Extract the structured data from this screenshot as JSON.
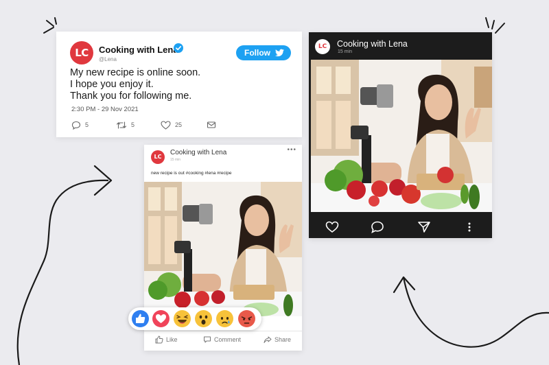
{
  "twitter": {
    "avatar_initials": "LC",
    "name": "Cooking with Lena",
    "handle": "@Lena",
    "follow_label": "Follow",
    "lines": [
      "My new recipe is online soon.",
      "I hope you enjoy it.",
      "Thank you for following me."
    ],
    "timestamp": "2:30 PM - 29 Nov 2021",
    "reply_count": "5",
    "retweet_count": "5",
    "like_count": "25",
    "icons": [
      "verified-icon",
      "twitter-bird-icon",
      "reply-icon",
      "retweet-icon",
      "heart-icon",
      "message-icon"
    ],
    "colors": {
      "accent": "#1da1f2",
      "avatar": "#e0383e"
    }
  },
  "instagram": {
    "avatar_initials": "LC",
    "name": "Cooking with Lena",
    "time": "15 min",
    "icons": [
      "heart-icon",
      "comment-icon",
      "share-icon",
      "more-icon"
    ],
    "colors": {
      "background": "#1c1c1c"
    }
  },
  "facebook": {
    "avatar_initials": "LC",
    "name": "Cooking with Lena",
    "sub": "15 min",
    "text": "new recipe is out #cooking #lena #recipe",
    "like_label": "Like",
    "comment_label": "Comment",
    "share_label": "Share",
    "reactions": [
      "like",
      "love",
      "haha",
      "wow",
      "sad",
      "angry"
    ]
  }
}
